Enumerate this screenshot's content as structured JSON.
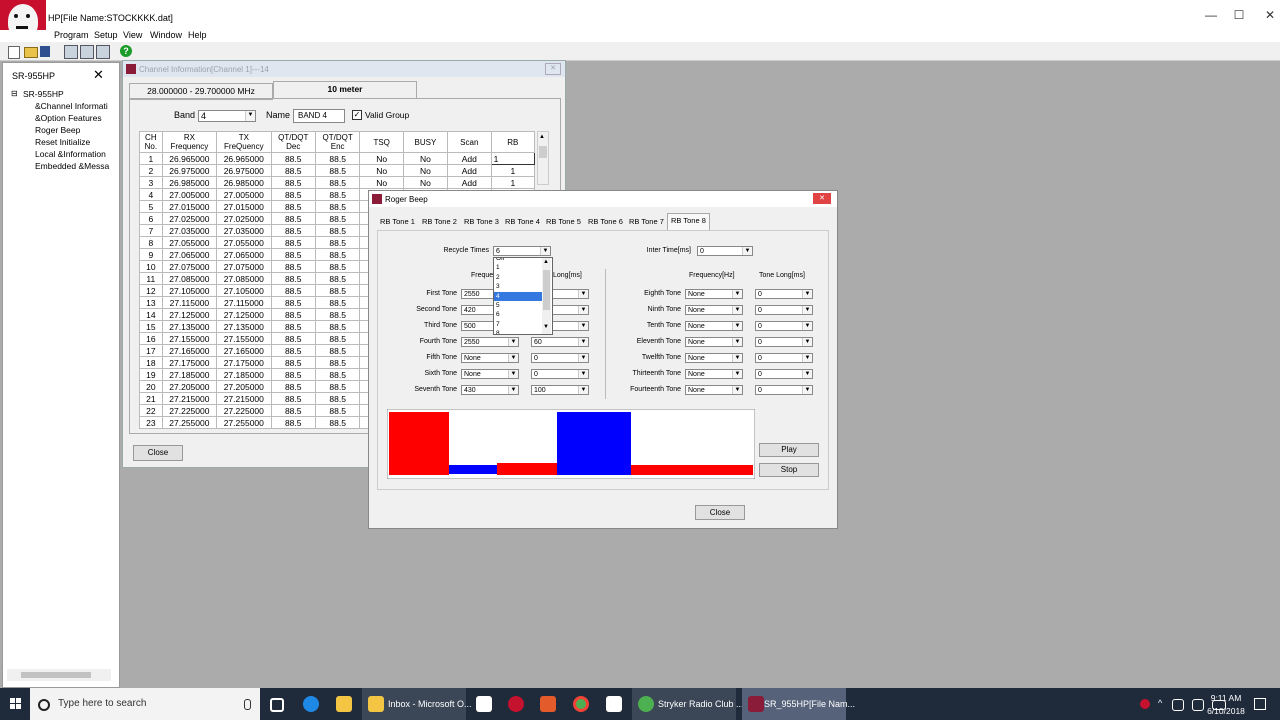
{
  "app": {
    "title": "HP[File Name:STOCKKKK.dat]",
    "menu": [
      "Program",
      "Setup",
      "View",
      "Window",
      "Help"
    ],
    "win_controls": {
      "minimize": "—",
      "maximize": "☐",
      "close": "✕"
    }
  },
  "left_panel": {
    "title": "SR-955HP",
    "close": "✕",
    "tree": [
      "SR-955HP",
      "&Channel Informati",
      "&Option Features",
      "Roger Beep",
      "Reset Initialize",
      "Local &Information",
      "Embedded &Messa"
    ],
    "expander": "⊟"
  },
  "channel_window": {
    "title": "Channel Information[Channel 1]---14",
    "close": "✕",
    "tabs": [
      "28.000000 - 29.700000 MHz",
      "10 meter"
    ],
    "band_label": "Band",
    "band_value": "4",
    "name_label": "Name",
    "name_value": "BAND 4",
    "valid_group_label": "Valid Group",
    "headers": [
      "CH No.",
      "RX Frequency",
      "TX FreQuency",
      "QT/DQT Dec",
      "QT/DQT Enc",
      "TSQ",
      "BUSY",
      "Scan",
      "RB"
    ],
    "rows": [
      [
        "1",
        "26.965000",
        "26.965000",
        "88.5",
        "88.5",
        "No",
        "No",
        "Add",
        "1"
      ],
      [
        "2",
        "26.975000",
        "26.975000",
        "88.5",
        "88.5",
        "No",
        "No",
        "Add",
        "1"
      ],
      [
        "3",
        "26.985000",
        "26.985000",
        "88.5",
        "88.5",
        "No",
        "No",
        "Add",
        "1"
      ],
      [
        "4",
        "27.005000",
        "27.005000",
        "88.5",
        "88.5",
        "",
        "",
        "",
        ""
      ],
      [
        "5",
        "27.015000",
        "27.015000",
        "88.5",
        "88.5",
        "",
        "",
        "",
        ""
      ],
      [
        "6",
        "27.025000",
        "27.025000",
        "88.5",
        "88.5",
        "",
        "",
        "",
        ""
      ],
      [
        "7",
        "27.035000",
        "27.035000",
        "88.5",
        "88.5",
        "",
        "",
        "",
        ""
      ],
      [
        "8",
        "27.055000",
        "27.055000",
        "88.5",
        "88.5",
        "",
        "",
        "",
        ""
      ],
      [
        "9",
        "27.065000",
        "27.065000",
        "88.5",
        "88.5",
        "",
        "",
        "",
        ""
      ],
      [
        "10",
        "27.075000",
        "27.075000",
        "88.5",
        "88.5",
        "",
        "",
        "",
        ""
      ],
      [
        "11",
        "27.085000",
        "27.085000",
        "88.5",
        "88.5",
        "",
        "",
        "",
        ""
      ],
      [
        "12",
        "27.105000",
        "27.105000",
        "88.5",
        "88.5",
        "",
        "",
        "",
        ""
      ],
      [
        "13",
        "27.115000",
        "27.115000",
        "88.5",
        "88.5",
        "",
        "",
        "",
        ""
      ],
      [
        "14",
        "27.125000",
        "27.125000",
        "88.5",
        "88.5",
        "",
        "",
        "",
        ""
      ],
      [
        "15",
        "27.135000",
        "27.135000",
        "88.5",
        "88.5",
        "",
        "",
        "",
        ""
      ],
      [
        "16",
        "27.155000",
        "27.155000",
        "88.5",
        "88.5",
        "",
        "",
        "",
        ""
      ],
      [
        "17",
        "27.165000",
        "27.165000",
        "88.5",
        "88.5",
        "",
        "",
        "",
        ""
      ],
      [
        "18",
        "27.175000",
        "27.175000",
        "88.5",
        "88.5",
        "",
        "",
        "",
        ""
      ],
      [
        "19",
        "27.185000",
        "27.185000",
        "88.5",
        "88.5",
        "",
        "",
        "",
        ""
      ],
      [
        "20",
        "27.205000",
        "27.205000",
        "88.5",
        "88.5",
        "",
        "",
        "",
        ""
      ],
      [
        "21",
        "27.215000",
        "27.215000",
        "88.5",
        "88.5",
        "",
        "",
        "",
        ""
      ],
      [
        "22",
        "27.225000",
        "27.225000",
        "88.5",
        "88.5",
        "",
        "",
        "",
        ""
      ],
      [
        "23",
        "27.255000",
        "27.255000",
        "88.5",
        "88.5",
        "",
        "",
        "",
        ""
      ]
    ],
    "close_button": "Close"
  },
  "roger_beep": {
    "title": "Roger Beep",
    "close": "✕",
    "tabs": [
      "RB Tone 1",
      "RB Tone 2",
      "RB Tone 3",
      "RB Tone 4",
      "RB Tone 5",
      "RB Tone 6",
      "RB Tone 7",
      "RB Tone 8"
    ],
    "recycle_label": "Recycle Times",
    "recycle_value": "6",
    "recycle_options": [
      "Off",
      "1",
      "2",
      "3",
      "4",
      "5",
      "6",
      "7",
      "8"
    ],
    "recycle_selected": "4",
    "inter_label": "Inter Time[ms]",
    "inter_value": "0",
    "freq_header_left": "Freque",
    "long_header_left": "Long[ms]",
    "freq_header_right": "Frequency[Hz]",
    "long_header_right": "Tone Long[ms]",
    "left_tones": [
      {
        "label": "First Tone",
        "freq": "2550",
        "long": ""
      },
      {
        "label": "Second Tone",
        "freq": "420",
        "long": ""
      },
      {
        "label": "Third Tone",
        "freq": "500",
        "long": ""
      },
      {
        "label": "Fourth Tone",
        "freq": "2550",
        "long": "60"
      },
      {
        "label": "Fifth Tone",
        "freq": "None",
        "long": "0"
      },
      {
        "label": "Sixth Tone",
        "freq": "None",
        "long": "0"
      },
      {
        "label": "Seventh Tone",
        "freq": "430",
        "long": "100"
      }
    ],
    "right_tones": [
      {
        "label": "Eighth Tone",
        "freq": "None",
        "long": "0"
      },
      {
        "label": "Ninth Tone",
        "freq": "None",
        "long": "0"
      },
      {
        "label": "Tenth Tone",
        "freq": "None",
        "long": "0"
      },
      {
        "label": "Eleventh Tone",
        "freq": "None",
        "long": "0"
      },
      {
        "label": "Twelfth Tone",
        "freq": "None",
        "long": "0"
      },
      {
        "label": "Thirteenth Tone",
        "freq": "None",
        "long": "0"
      },
      {
        "label": "Fourteenth Tone",
        "freq": "None",
        "long": "0"
      }
    ],
    "play_button": "Play",
    "stop_button": "Stop",
    "close_button": "Close",
    "colors": {
      "red": "#ff0000",
      "blue": "#0000ff"
    }
  },
  "taskbar": {
    "search_placeholder": "Type here to search",
    "apps": [
      "Inbox - Microsoft O...",
      "Stryker Radio Club ...",
      "SR_955HP[File Nam..."
    ],
    "time": "9:11 AM",
    "date": "6/10/2018"
  }
}
